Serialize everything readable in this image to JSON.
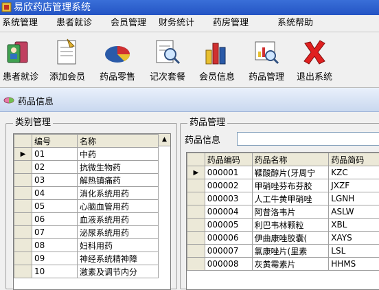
{
  "window": {
    "title": "易欣药店管理系统"
  },
  "menu": [
    "系统管理",
    "患者就诊",
    "会员管理",
    "财务统计",
    "药房管理",
    "系统帮助"
  ],
  "toolbar": [
    {
      "label": "患者就诊",
      "icon": "patient-icon"
    },
    {
      "label": "添加会员",
      "icon": "add-member-icon"
    },
    {
      "label": "药品零售",
      "icon": "pie-chart-icon"
    },
    {
      "label": "记次套餐",
      "icon": "magnifier-document-icon"
    },
    {
      "label": "会员信息",
      "icon": "bar-chart-icon"
    },
    {
      "label": "药品管理",
      "icon": "magnifier-chart-icon"
    },
    {
      "label": "退出系统",
      "icon": "red-x-icon"
    }
  ],
  "child_window": {
    "title": "药品信息"
  },
  "category_group": {
    "label": "类别管理",
    "headers": [
      "编号",
      "名称"
    ],
    "rows": [
      [
        "01",
        "中药"
      ],
      [
        "02",
        "抗微生物药"
      ],
      [
        "03",
        "解热镇痛药"
      ],
      [
        "04",
        "消化系统用药"
      ],
      [
        "05",
        "心脑血管用药"
      ],
      [
        "06",
        "血液系统用药"
      ],
      [
        "07",
        "泌尿系统用药"
      ],
      [
        "08",
        "妇科用药"
      ],
      [
        "09",
        "神经系统精神障"
      ],
      [
        "10",
        "激素及调节内分"
      ]
    ],
    "current_row_marker": "▶"
  },
  "drug_group": {
    "label": "药品管理",
    "search_label": "药品信息",
    "search_value": "",
    "headers": [
      "药品编码",
      "药品名称",
      "药品简码"
    ],
    "rows": [
      [
        "000001",
        "鞣酸醇片(牙周宁",
        "KZC"
      ],
      [
        "000002",
        "甲硝唑芬布芬胶",
        "JXZF"
      ],
      [
        "000003",
        "人工牛黄甲硝唑",
        "LGNH"
      ],
      [
        "000004",
        "阿昔洛韦片",
        "ASLW"
      ],
      [
        "000005",
        "利巴韦林颗粒",
        "XBL"
      ],
      [
        "000006",
        "伊曲康唑胶囊(",
        "XAYS"
      ],
      [
        "000007",
        "氯康唑片(里素",
        "LSL"
      ],
      [
        "000008",
        "灰黄霉素片",
        "HHMS"
      ]
    ],
    "current_row_marker": "▶"
  }
}
